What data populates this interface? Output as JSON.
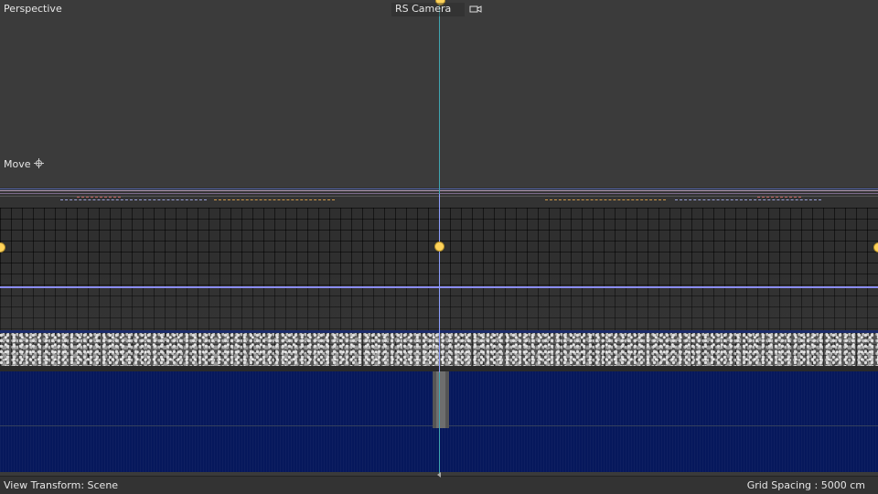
{
  "viewport": {
    "view_name": "Perspective",
    "camera_name": "RS Camera",
    "tool_label": "Move",
    "icons": {
      "move": "move-cross-icon",
      "camera": "camera-icon"
    },
    "colors": {
      "axis_vertical": "#3fa5b0",
      "guide_line": "#8a8cf0",
      "handle": "#ffd35a",
      "water": "#06185c"
    }
  },
  "statusbar": {
    "view_transform": "View Transform: Scene",
    "grid_spacing": "Grid Spacing : 5000 cm"
  }
}
